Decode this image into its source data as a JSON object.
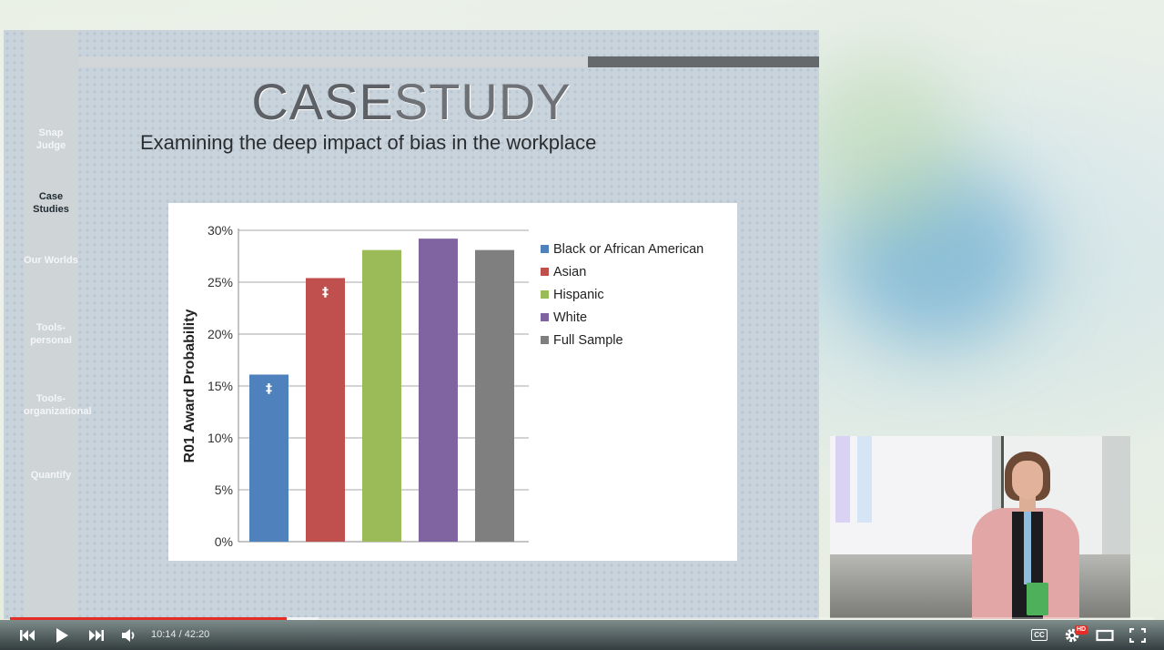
{
  "slide": {
    "sidebar_items": [
      {
        "label": "Snap Judge",
        "active": false
      },
      {
        "label": "Case Studies",
        "active": true
      },
      {
        "label": "Our Worlds",
        "active": false
      },
      {
        "label": "Tools-personal",
        "active": false
      },
      {
        "label": "Tools-organizational",
        "active": false
      },
      {
        "label": "Quantify",
        "active": false
      }
    ],
    "title_bold": "CASE",
    "title_thin": "STUDY",
    "subtitle": "Examining the deep impact of bias in the workplace"
  },
  "chart_data": {
    "type": "bar",
    "title": "",
    "xlabel": "",
    "ylabel": "R01 Award Probability",
    "ylim": [
      0,
      30
    ],
    "yticks": [
      "0%",
      "5%",
      "10%",
      "15%",
      "20%",
      "25%",
      "30%"
    ],
    "grid": true,
    "legend_position": "right",
    "series": [
      {
        "name": "Black or African American",
        "value": 16.1,
        "color": "#4f81bd",
        "annotation": "‡"
      },
      {
        "name": "Asian",
        "value": 25.4,
        "color": "#c0504d",
        "annotation": "‡"
      },
      {
        "name": "Hispanic",
        "value": 28.1,
        "color": "#9bbb59",
        "annotation": ""
      },
      {
        "name": "White",
        "value": 29.2,
        "color": "#8064a2",
        "annotation": ""
      },
      {
        "name": "Full Sample",
        "value": 28.1,
        "color": "#7f7f7f",
        "annotation": ""
      }
    ]
  },
  "player": {
    "current_time": "10:14",
    "separator": " / ",
    "duration": "42:20",
    "played_fraction": 0.2417,
    "buffered_fraction": 0.27,
    "cc_label": "CC",
    "hd_label": "HD",
    "icons": {
      "previous": "skip-previous-icon",
      "play": "play-icon",
      "next": "skip-next-icon",
      "volume": "volume-icon",
      "settings": "gear-icon",
      "theater": "theater-mode-icon",
      "fullscreen": "fullscreen-icon"
    },
    "accent_color": "#e52d27"
  }
}
